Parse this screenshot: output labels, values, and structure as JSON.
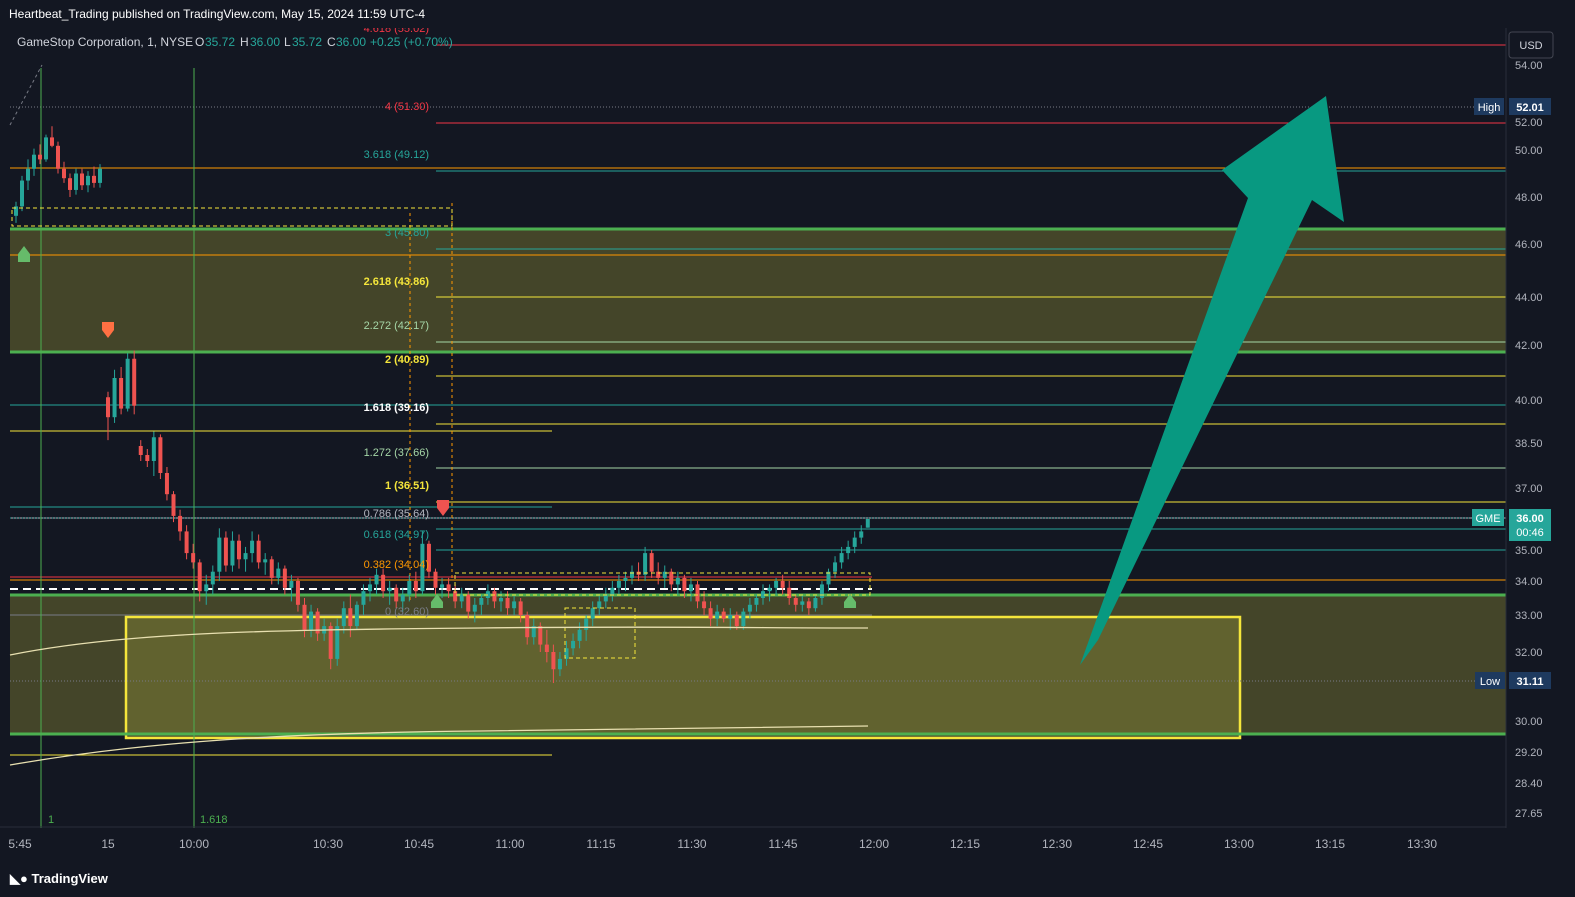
{
  "header": {
    "published": "Heartbeat_Trading published on TradingView.com, May 15, 2024 11:59 UTC-4"
  },
  "legend": {
    "symbol": "GameStop Corporation, 1, NYSE",
    "o_label": "O",
    "o_value": "35.72",
    "h_label": "H",
    "h_value": "36.00",
    "l_label": "L",
    "l_value": "35.72",
    "c_label": "C",
    "c_value": "36.00",
    "change": "+0.25 (+0.70%)"
  },
  "footer": {
    "brand": "TradingView"
  },
  "colors": {
    "bg": "#131722",
    "up": "#26a69a",
    "down": "#ef5350",
    "green_line": "#4caf50",
    "zone": "#4a4a2a",
    "yellow_box": "#f5e63b",
    "arrow": "#089981",
    "axis_text": "#b2b5be"
  },
  "chart_data": {
    "type": "candlestick",
    "title": "GameStop Corporation, 1, NYSE",
    "currency": "USD",
    "y_ticks": [
      "54.00",
      "52.00",
      "50.00",
      "48.00",
      "46.00",
      "44.00",
      "42.00",
      "40.00",
      "38.50",
      "37.00",
      "35.00",
      "34.00",
      "33.00",
      "32.00",
      "30.00",
      "29.20",
      "28.40",
      "27.65"
    ],
    "x_ticks": [
      "5:45",
      "15",
      "10:00",
      "10:30",
      "10:45",
      "11:00",
      "11:15",
      "11:30",
      "11:45",
      "12:00",
      "12:15",
      "12:30",
      "12:45",
      "13:00",
      "13:15",
      "13:30"
    ],
    "price_labels": [
      {
        "name": "High",
        "value": "52.01"
      },
      {
        "name": "GME",
        "value": "36.00",
        "countdown": "00:46"
      },
      {
        "name": "Low",
        "value": "31.11"
      }
    ],
    "fib_levels": [
      {
        "label": "4.618 (55.02)",
        "color": "#f23645"
      },
      {
        "label": "4 (51.30)",
        "color": "#f23645"
      },
      {
        "label": "3.618 (49.12)",
        "color": "#26a69a"
      },
      {
        "label": "3 (45.80)",
        "color": "#26a69a"
      },
      {
        "label": "2.618 (43.86)",
        "color": "#f5e63b"
      },
      {
        "label": "2.272 (42.17)",
        "color": "#a5d6a7"
      },
      {
        "label": "2 (40.89)",
        "color": "#f5e63b"
      },
      {
        "label": "1.618 (39.16)",
        "color": "#ffffff"
      },
      {
        "label": "1.272 (37.66)",
        "color": "#a5d6a7"
      },
      {
        "label": "1 (36.51)",
        "color": "#f5e63b"
      },
      {
        "label": "0.786 (35.64)",
        "color": "#b2b5be"
      },
      {
        "label": "0.618 (34.97)",
        "color": "#26a69a"
      },
      {
        "label": "0.382 (34.04)",
        "color": "#ff9800"
      },
      {
        "label": "0 (32.60)",
        "color": "#787b86"
      }
    ],
    "fib_time_labels": [
      "1",
      "1.618"
    ],
    "candles": [
      {
        "o": 47.2,
        "h": 47.8,
        "l": 46.9,
        "c": 47.6
      },
      {
        "o": 47.6,
        "h": 48.9,
        "l": 47.4,
        "c": 48.7
      },
      {
        "o": 48.7,
        "h": 49.6,
        "l": 48.3,
        "c": 49.2
      },
      {
        "o": 49.2,
        "h": 50.1,
        "l": 48.9,
        "c": 49.8
      },
      {
        "o": 49.8,
        "h": 50.4,
        "l": 49.4,
        "c": 49.6
      },
      {
        "o": 49.6,
        "h": 51.1,
        "l": 49.5,
        "c": 50.9
      },
      {
        "o": 50.9,
        "h": 51.7,
        "l": 50.2,
        "c": 50.3
      },
      {
        "o": 50.3,
        "h": 50.6,
        "l": 49.0,
        "c": 49.2
      },
      {
        "o": 49.2,
        "h": 49.5,
        "l": 48.6,
        "c": 48.8
      },
      {
        "o": 48.8,
        "h": 49.0,
        "l": 48.0,
        "c": 48.3
      },
      {
        "o": 48.3,
        "h": 49.2,
        "l": 48.1,
        "c": 49.0
      },
      {
        "o": 49.0,
        "h": 49.2,
        "l": 48.3,
        "c": 48.5
      },
      {
        "o": 48.5,
        "h": 49.1,
        "l": 48.2,
        "c": 48.9
      },
      {
        "o": 48.9,
        "h": 49.3,
        "l": 48.4,
        "c": 48.6
      },
      {
        "o": 48.6,
        "h": 49.4,
        "l": 48.4,
        "c": 49.2
      },
      {
        "o": 40.1,
        "h": 40.3,
        "l": 38.6,
        "c": 39.4
      },
      {
        "o": 39.4,
        "h": 41.1,
        "l": 39.2,
        "c": 40.8
      },
      {
        "o": 40.8,
        "h": 41.2,
        "l": 39.5,
        "c": 39.7
      },
      {
        "o": 39.7,
        "h": 41.7,
        "l": 39.6,
        "c": 41.5
      },
      {
        "o": 41.5,
        "h": 41.8,
        "l": 39.5,
        "c": 39.8
      },
      {
        "o": 38.4,
        "h": 38.6,
        "l": 37.9,
        "c": 38.1
      },
      {
        "o": 38.1,
        "h": 38.3,
        "l": 37.7,
        "c": 37.9
      },
      {
        "o": 37.9,
        "h": 38.9,
        "l": 37.4,
        "c": 38.7
      },
      {
        "o": 38.7,
        "h": 38.8,
        "l": 37.3,
        "c": 37.5
      },
      {
        "o": 37.5,
        "h": 37.7,
        "l": 36.6,
        "c": 36.8
      },
      {
        "o": 36.8,
        "h": 36.9,
        "l": 35.9,
        "c": 36.1
      },
      {
        "o": 36.1,
        "h": 36.3,
        "l": 35.3,
        "c": 35.6
      },
      {
        "o": 35.6,
        "h": 35.8,
        "l": 34.7,
        "c": 34.9
      },
      {
        "o": 34.9,
        "h": 35.2,
        "l": 34.4,
        "c": 34.6
      },
      {
        "o": 34.6,
        "h": 34.7,
        "l": 33.4,
        "c": 33.7
      },
      {
        "o": 33.7,
        "h": 34.2,
        "l": 33.3,
        "c": 33.9
      },
      {
        "o": 33.9,
        "h": 34.5,
        "l": 33.6,
        "c": 34.3
      },
      {
        "o": 34.3,
        "h": 35.7,
        "l": 34.0,
        "c": 35.4
      },
      {
        "o": 35.4,
        "h": 35.6,
        "l": 34.3,
        "c": 34.5
      },
      {
        "o": 34.5,
        "h": 35.6,
        "l": 34.3,
        "c": 35.3
      },
      {
        "o": 35.3,
        "h": 35.5,
        "l": 34.4,
        "c": 34.7
      },
      {
        "o": 34.7,
        "h": 35.1,
        "l": 34.3,
        "c": 34.9
      },
      {
        "o": 34.9,
        "h": 35.6,
        "l": 34.6,
        "c": 35.3
      },
      {
        "o": 35.3,
        "h": 35.5,
        "l": 34.4,
        "c": 34.6
      },
      {
        "o": 34.6,
        "h": 34.9,
        "l": 34.2,
        "c": 34.7
      },
      {
        "o": 34.7,
        "h": 34.8,
        "l": 33.9,
        "c": 34.1
      },
      {
        "o": 34.1,
        "h": 34.6,
        "l": 33.9,
        "c": 34.4
      },
      {
        "o": 34.4,
        "h": 34.5,
        "l": 33.6,
        "c": 33.8
      },
      {
        "o": 33.8,
        "h": 34.2,
        "l": 33.4,
        "c": 34.0
      },
      {
        "o": 34.0,
        "h": 34.1,
        "l": 33.1,
        "c": 33.3
      },
      {
        "o": 33.3,
        "h": 33.5,
        "l": 32.4,
        "c": 32.6
      },
      {
        "o": 32.6,
        "h": 33.3,
        "l": 32.4,
        "c": 33.1
      },
      {
        "o": 33.1,
        "h": 33.2,
        "l": 32.3,
        "c": 32.5
      },
      {
        "o": 32.5,
        "h": 32.9,
        "l": 32.3,
        "c": 32.7
      },
      {
        "o": 32.7,
        "h": 32.8,
        "l": 31.5,
        "c": 31.8
      },
      {
        "o": 31.8,
        "h": 32.9,
        "l": 31.6,
        "c": 32.7
      },
      {
        "o": 32.7,
        "h": 33.4,
        "l": 32.5,
        "c": 33.2
      },
      {
        "o": 33.2,
        "h": 33.6,
        "l": 32.4,
        "c": 32.7
      },
      {
        "o": 32.7,
        "h": 33.4,
        "l": 32.6,
        "c": 33.3
      },
      {
        "o": 33.3,
        "h": 33.9,
        "l": 33.0,
        "c": 33.7
      },
      {
        "o": 33.7,
        "h": 34.1,
        "l": 33.4,
        "c": 33.9
      },
      {
        "o": 33.9,
        "h": 34.4,
        "l": 33.6,
        "c": 34.2
      },
      {
        "o": 34.2,
        "h": 34.4,
        "l": 33.5,
        "c": 33.7
      },
      {
        "o": 33.7,
        "h": 34.0,
        "l": 33.3,
        "c": 33.8
      },
      {
        "o": 33.8,
        "h": 33.9,
        "l": 33.2,
        "c": 33.4
      },
      {
        "o": 33.4,
        "h": 33.8,
        "l": 33.1,
        "c": 33.6
      },
      {
        "o": 33.6,
        "h": 34.2,
        "l": 33.4,
        "c": 34.0
      },
      {
        "o": 34.0,
        "h": 34.3,
        "l": 33.5,
        "c": 33.7
      },
      {
        "o": 33.7,
        "h": 35.6,
        "l": 33.6,
        "c": 35.2
      },
      {
        "o": 35.2,
        "h": 35.3,
        "l": 34.1,
        "c": 34.3
      },
      {
        "o": 34.3,
        "h": 34.4,
        "l": 33.6,
        "c": 33.8
      },
      {
        "o": 33.8,
        "h": 34.1,
        "l": 33.5,
        "c": 33.9
      },
      {
        "o": 33.9,
        "h": 34.1,
        "l": 33.5,
        "c": 33.7
      },
      {
        "o": 33.7,
        "h": 33.9,
        "l": 33.2,
        "c": 33.4
      },
      {
        "o": 33.4,
        "h": 33.8,
        "l": 33.2,
        "c": 33.6
      },
      {
        "o": 33.6,
        "h": 33.7,
        "l": 32.9,
        "c": 33.1
      },
      {
        "o": 33.1,
        "h": 33.5,
        "l": 32.8,
        "c": 33.3
      },
      {
        "o": 33.3,
        "h": 33.6,
        "l": 33.0,
        "c": 33.5
      },
      {
        "o": 33.5,
        "h": 33.9,
        "l": 33.3,
        "c": 33.7
      },
      {
        "o": 33.7,
        "h": 33.8,
        "l": 33.2,
        "c": 33.4
      },
      {
        "o": 33.4,
        "h": 33.7,
        "l": 33.1,
        "c": 33.5
      },
      {
        "o": 33.5,
        "h": 33.7,
        "l": 33.0,
        "c": 33.2
      },
      {
        "o": 33.2,
        "h": 33.6,
        "l": 33.0,
        "c": 33.4
      },
      {
        "o": 33.4,
        "h": 33.5,
        "l": 32.8,
        "c": 33.0
      },
      {
        "o": 33.0,
        "h": 33.1,
        "l": 32.2,
        "c": 32.4
      },
      {
        "o": 32.4,
        "h": 32.9,
        "l": 32.2,
        "c": 32.7
      },
      {
        "o": 32.7,
        "h": 32.8,
        "l": 32.0,
        "c": 32.2
      },
      {
        "o": 32.2,
        "h": 32.6,
        "l": 31.7,
        "c": 32.0
      },
      {
        "o": 32.0,
        "h": 32.2,
        "l": 31.1,
        "c": 31.5
      },
      {
        "o": 31.5,
        "h": 32.0,
        "l": 31.3,
        "c": 31.8
      },
      {
        "o": 31.8,
        "h": 32.3,
        "l": 31.6,
        "c": 32.1
      },
      {
        "o": 32.1,
        "h": 32.5,
        "l": 31.9,
        "c": 32.3
      },
      {
        "o": 32.3,
        "h": 32.8,
        "l": 32.1,
        "c": 32.6
      },
      {
        "o": 32.6,
        "h": 33.0,
        "l": 32.3,
        "c": 32.9
      },
      {
        "o": 32.9,
        "h": 33.4,
        "l": 32.7,
        "c": 33.2
      },
      {
        "o": 33.2,
        "h": 33.6,
        "l": 33.0,
        "c": 33.4
      },
      {
        "o": 33.4,
        "h": 33.8,
        "l": 33.2,
        "c": 33.6
      },
      {
        "o": 33.6,
        "h": 34.0,
        "l": 33.4,
        "c": 33.8
      },
      {
        "o": 33.8,
        "h": 34.2,
        "l": 33.6,
        "c": 34.0
      },
      {
        "o": 34.0,
        "h": 34.3,
        "l": 33.7,
        "c": 34.1
      },
      {
        "o": 34.1,
        "h": 34.5,
        "l": 33.9,
        "c": 34.3
      },
      {
        "o": 34.3,
        "h": 34.6,
        "l": 34.0,
        "c": 34.2
      },
      {
        "o": 34.2,
        "h": 35.1,
        "l": 34.0,
        "c": 34.9
      },
      {
        "o": 34.9,
        "h": 35.0,
        "l": 34.1,
        "c": 34.3
      },
      {
        "o": 34.3,
        "h": 34.6,
        "l": 33.9,
        "c": 34.1
      },
      {
        "o": 34.1,
        "h": 34.5,
        "l": 33.8,
        "c": 34.3
      },
      {
        "o": 34.3,
        "h": 34.4,
        "l": 33.7,
        "c": 33.9
      },
      {
        "o": 33.9,
        "h": 34.3,
        "l": 33.6,
        "c": 34.1
      },
      {
        "o": 34.1,
        "h": 34.2,
        "l": 33.5,
        "c": 33.7
      },
      {
        "o": 33.7,
        "h": 34.1,
        "l": 33.4,
        "c": 33.9
      },
      {
        "o": 33.9,
        "h": 34.0,
        "l": 33.2,
        "c": 33.4
      },
      {
        "o": 33.4,
        "h": 33.7,
        "l": 33.0,
        "c": 33.2
      },
      {
        "o": 33.2,
        "h": 33.4,
        "l": 32.7,
        "c": 32.9
      },
      {
        "o": 32.9,
        "h": 33.3,
        "l": 32.7,
        "c": 33.1
      },
      {
        "o": 33.1,
        "h": 33.2,
        "l": 32.8,
        "c": 32.9
      },
      {
        "o": 32.9,
        "h": 33.2,
        "l": 32.6,
        "c": 33.0
      },
      {
        "o": 33.0,
        "h": 33.1,
        "l": 32.6,
        "c": 32.7
      },
      {
        "o": 32.7,
        "h": 33.2,
        "l": 32.6,
        "c": 33.1
      },
      {
        "o": 33.1,
        "h": 33.5,
        "l": 32.9,
        "c": 33.3
      },
      {
        "o": 33.3,
        "h": 33.6,
        "l": 33.1,
        "c": 33.5
      },
      {
        "o": 33.5,
        "h": 33.9,
        "l": 33.3,
        "c": 33.7
      },
      {
        "o": 33.7,
        "h": 33.9,
        "l": 33.4,
        "c": 33.8
      },
      {
        "o": 33.8,
        "h": 34.1,
        "l": 33.6,
        "c": 34.0
      },
      {
        "o": 34.0,
        "h": 34.2,
        "l": 33.6,
        "c": 33.8
      },
      {
        "o": 33.8,
        "h": 34.0,
        "l": 33.3,
        "c": 33.5
      },
      {
        "o": 33.5,
        "h": 33.6,
        "l": 33.1,
        "c": 33.3
      },
      {
        "o": 33.3,
        "h": 33.6,
        "l": 33.1,
        "c": 33.4
      },
      {
        "o": 33.4,
        "h": 33.5,
        "l": 33.0,
        "c": 33.2
      },
      {
        "o": 33.2,
        "h": 33.6,
        "l": 33.1,
        "c": 33.5
      },
      {
        "o": 33.5,
        "h": 34.0,
        "l": 33.3,
        "c": 33.9
      },
      {
        "o": 33.9,
        "h": 34.4,
        "l": 33.7,
        "c": 34.3
      },
      {
        "o": 34.3,
        "h": 34.8,
        "l": 34.1,
        "c": 34.6
      },
      {
        "o": 34.6,
        "h": 35.1,
        "l": 34.4,
        "c": 34.9
      },
      {
        "o": 34.9,
        "h": 35.3,
        "l": 34.7,
        "c": 35.1
      },
      {
        "o": 35.1,
        "h": 35.6,
        "l": 34.9,
        "c": 35.4
      },
      {
        "o": 35.4,
        "h": 35.8,
        "l": 35.2,
        "c": 35.6
      },
      {
        "o": 35.72,
        "h": 36.0,
        "l": 35.72,
        "c": 36.0
      }
    ]
  }
}
